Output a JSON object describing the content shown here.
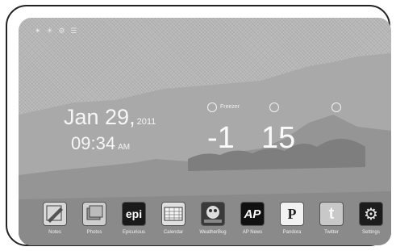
{
  "status_bar": {
    "text": "✶ ☀ ⚙ ☰"
  },
  "clock": {
    "date_main": "Jan 29,",
    "date_year": "2011",
    "time": "09:34",
    "ampm": "AM"
  },
  "weather": {
    "left_label": "Freezer",
    "left_value": "-1",
    "mid_label": "",
    "right_value": "15"
  },
  "dock": {
    "apps": [
      {
        "label": "Notes",
        "icon": "notes-icon",
        "glyph": ""
      },
      {
        "label": "Photos",
        "icon": "photos-icon",
        "glyph": ""
      },
      {
        "label": "Epicurious",
        "icon": "epicurious-icon",
        "glyph": "epi"
      },
      {
        "label": "Calendar",
        "icon": "calendar-icon",
        "glyph": ""
      },
      {
        "label": "WeatherBug",
        "icon": "weatherbug-icon",
        "glyph": ""
      },
      {
        "label": "AP News",
        "icon": "ap-news-icon",
        "glyph": "AP"
      },
      {
        "label": "Pandora",
        "icon": "pandora-icon",
        "glyph": "P"
      },
      {
        "label": "Twitter",
        "icon": "twitter-icon",
        "glyph": "t"
      },
      {
        "label": "Settings",
        "icon": "settings-icon",
        "glyph": "⚙"
      }
    ]
  },
  "colors": {
    "screen_bg": "#bdbdbd",
    "text": "#f6f6f6",
    "frame": "#222222"
  }
}
